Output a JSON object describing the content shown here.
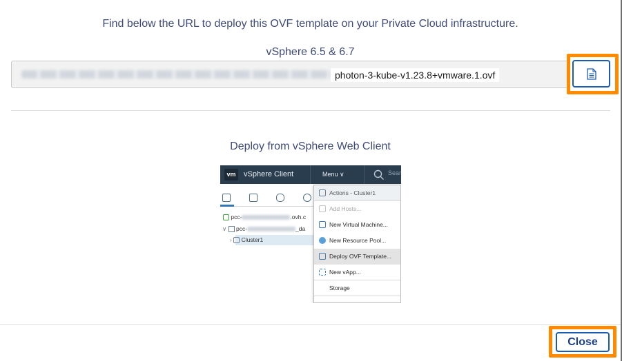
{
  "dialog": {
    "intro_text": "Find below the URL to deploy this OVF template on your Private Cloud infrastructure.",
    "version_label": "vSphere 6.5 & 6.7",
    "url_visible_part": "photon-3-kube-v1.23.8+vmware.1.ovf",
    "copy_button_icon": "document-copy-icon",
    "deploy_title": "Deploy from vSphere Web Client",
    "close_label": "Close",
    "highlight_color": "#ff8a00",
    "accent_color": "#1a5cb3"
  },
  "vsphere_screenshot": {
    "logo": "vm",
    "app_name": "vSphere Client",
    "menu_label": "Menu ∨",
    "search_label": "Sear",
    "tree": {
      "datacenter_prefix": "pcc-",
      "datacenter_suffix": ".ovh.c",
      "pool_prefix": "pcc-",
      "pool_suffix": "_da",
      "cluster": "Cluster1"
    },
    "context_menu": [
      {
        "label": "Actions - Cluster1",
        "icon": "cluster-icon",
        "state": "header"
      },
      {
        "label": "Add Hosts...",
        "icon": "add-host-icon",
        "state": "disabled"
      },
      {
        "label": "New Virtual Machine...",
        "icon": "new-vm-icon",
        "state": "normal"
      },
      {
        "label": "New Resource Pool...",
        "icon": "resource-pool-icon",
        "state": "normal"
      },
      {
        "label": "Deploy OVF Template...",
        "icon": "deploy-ovf-icon",
        "state": "highlighted"
      },
      {
        "label": "New vApp...",
        "icon": "vapp-icon",
        "state": "normal"
      },
      {
        "label": "Storage",
        "icon": "",
        "state": "normal"
      }
    ]
  }
}
